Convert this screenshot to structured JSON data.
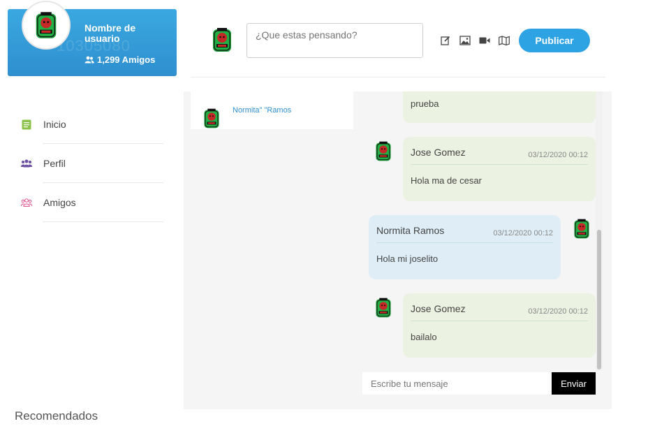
{
  "profile": {
    "name": "Nombre de usuario",
    "friends_count": "1,299 Amigos",
    "ghost_id": "10305080",
    "avatar_icon": "user-avatar-logo-icon"
  },
  "nav": {
    "items": [
      {
        "label": "Inicio",
        "icon": "book-icon",
        "color": "#8bc34a"
      },
      {
        "label": "Perfil",
        "icon": "users-icon",
        "color": "#6b4fa0"
      },
      {
        "label": "Amigos",
        "icon": "friends-outline-icon",
        "color": "#e0508a"
      }
    ]
  },
  "recommended_title": "Recomendados",
  "post": {
    "placeholder": "¿Que estas pensando?",
    "publish_label": "Publicar",
    "icons": [
      "edit-icon",
      "image-icon",
      "video-icon",
      "map-icon"
    ]
  },
  "chat": {
    "contacts": [
      {
        "name": "Normita\" \"Ramos"
      }
    ],
    "messages": [
      {
        "type": "received",
        "text": "prueba"
      },
      {
        "type": "received",
        "author": "Jose Gomez",
        "time": "03/12/2020 00:12",
        "text": "Hola ma de cesar"
      },
      {
        "type": "sent",
        "author": "Normita Ramos",
        "time": "03/12/2020 00:12",
        "text": "Hola mi joselito"
      },
      {
        "type": "received",
        "author": "Jose Gomez",
        "time": "03/12/2020 00:12",
        "text": "bailalo"
      }
    ],
    "input_placeholder": "Escribe tu mensaje",
    "send_label": "Enviar"
  },
  "colors": {
    "accent": "#2ea3e3",
    "received_bubble": "#ebf2e2",
    "sent_bubble": "#dfeef6"
  }
}
